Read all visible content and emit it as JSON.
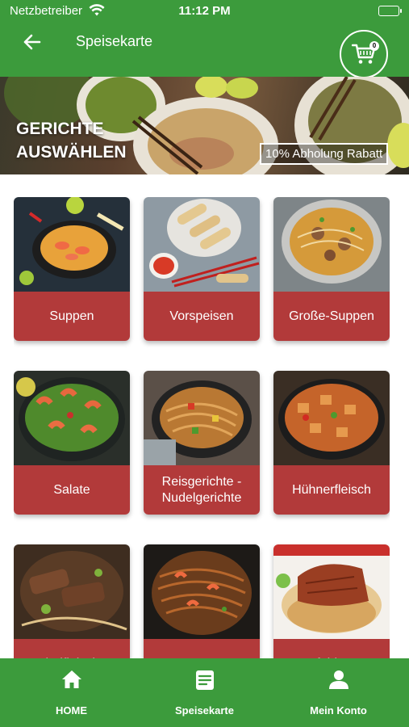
{
  "status_bar": {
    "carrier": "Netzbetreiber",
    "time": "11:12 PM"
  },
  "header": {
    "title": "Speisekarte",
    "cart_count": "0"
  },
  "banner": {
    "title_line1": "GERICHTE",
    "title_line2": "AUSWÄHLEN",
    "promo": "10% Abholung Rabatt"
  },
  "categories": [
    {
      "label": "Suppen",
      "icon": "soup-photo"
    },
    {
      "label": "Vorspeisen",
      "icon": "spring-rolls-photo"
    },
    {
      "label": "Große-Suppen",
      "icon": "big-soup-photo"
    },
    {
      "label": "Salate",
      "icon": "salad-photo"
    },
    {
      "label": "Reisgerichte - Nudelgerichte",
      "icon": "noodles-photo"
    },
    {
      "label": "Hühnerfleisch",
      "icon": "chicken-photo"
    },
    {
      "label": "Rindfleisch -",
      "icon": "beef-photo"
    },
    {
      "label": "",
      "icon": "shrimp-noodles-photo"
    },
    {
      "label": "Empfehlungen",
      "icon": "duck-photo"
    }
  ],
  "bottom_nav": [
    {
      "label": "HOME",
      "icon": "home-icon"
    },
    {
      "label": "Speisekarte",
      "icon": "menu-icon"
    },
    {
      "label": "Mein Konto",
      "icon": "person-icon"
    }
  ],
  "colors": {
    "primary": "#3c9b3c",
    "card_label": "#b23a3a"
  }
}
